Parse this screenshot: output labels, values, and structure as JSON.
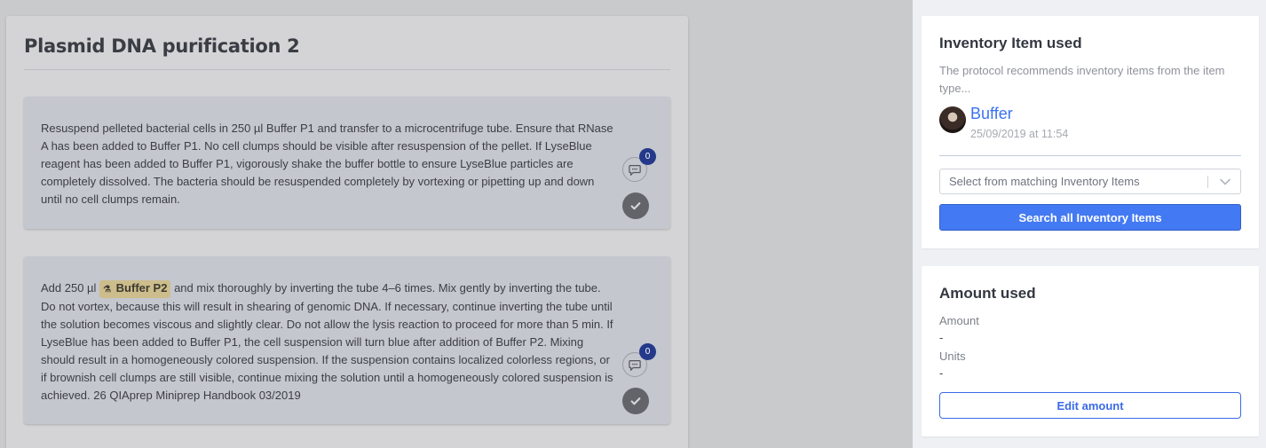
{
  "protocol": {
    "title": "Plasmid DNA purification 2",
    "steps": [
      {
        "text": "Resuspend pelleted bacterial cells in 250 µl Buffer P1 and transfer to a microcentrifuge tube. Ensure that RNase A has been added to Buffer P1. No cell clumps should be visible after resuspension of the pellet. If LyseBlue reagent has been added to Buffer P1, vigorously shake the buffer bottle to ensure LyseBlue particles are completely dissolved. The bacteria should be resuspended completely by vortexing or pipetting up and down until no cell clumps remain.",
        "comment_count": "0"
      },
      {
        "text_before": "Add 250 µl",
        "reagent": "Buffer P2",
        "text_after": "and mix thoroughly by inverting the tube 4–6 times. Mix gently by inverting the tube. Do not vortex, because this will result in shearing of genomic DNA. If necessary, continue inverting the tube until the solution becomes viscous and slightly clear. Do not allow the lysis reaction to proceed for more than 5 min. If LyseBlue has been added to Buffer P1, the cell suspension will turn blue after addition of Buffer P2. Mixing should result in a homogeneously colored suspension. If the suspension contains localized colorless regions, or if brownish cell clumps are still visible, continue mixing the solution until a homogeneously colored suspension is achieved. 26 QIAprep Miniprep Handbook 03/2019",
        "comment_count": "0"
      }
    ]
  },
  "inventory_panel": {
    "title": "Inventory Item used",
    "description": "The protocol recommends inventory items from the item type...",
    "item_name": "Buffer",
    "item_date": "25/09/2019 at 11:54",
    "select_placeholder": "Select from matching Inventory Items",
    "search_button": "Search all Inventory Items"
  },
  "amount_panel": {
    "title": "Amount used",
    "amount_label": "Amount",
    "amount_value": "-",
    "units_label": "Units",
    "units_value": "-",
    "edit_button": "Edit amount"
  },
  "colors": {
    "accent": "#4379f2",
    "badge": "#24398a",
    "reagent_highlight": "#cdbd8c"
  }
}
